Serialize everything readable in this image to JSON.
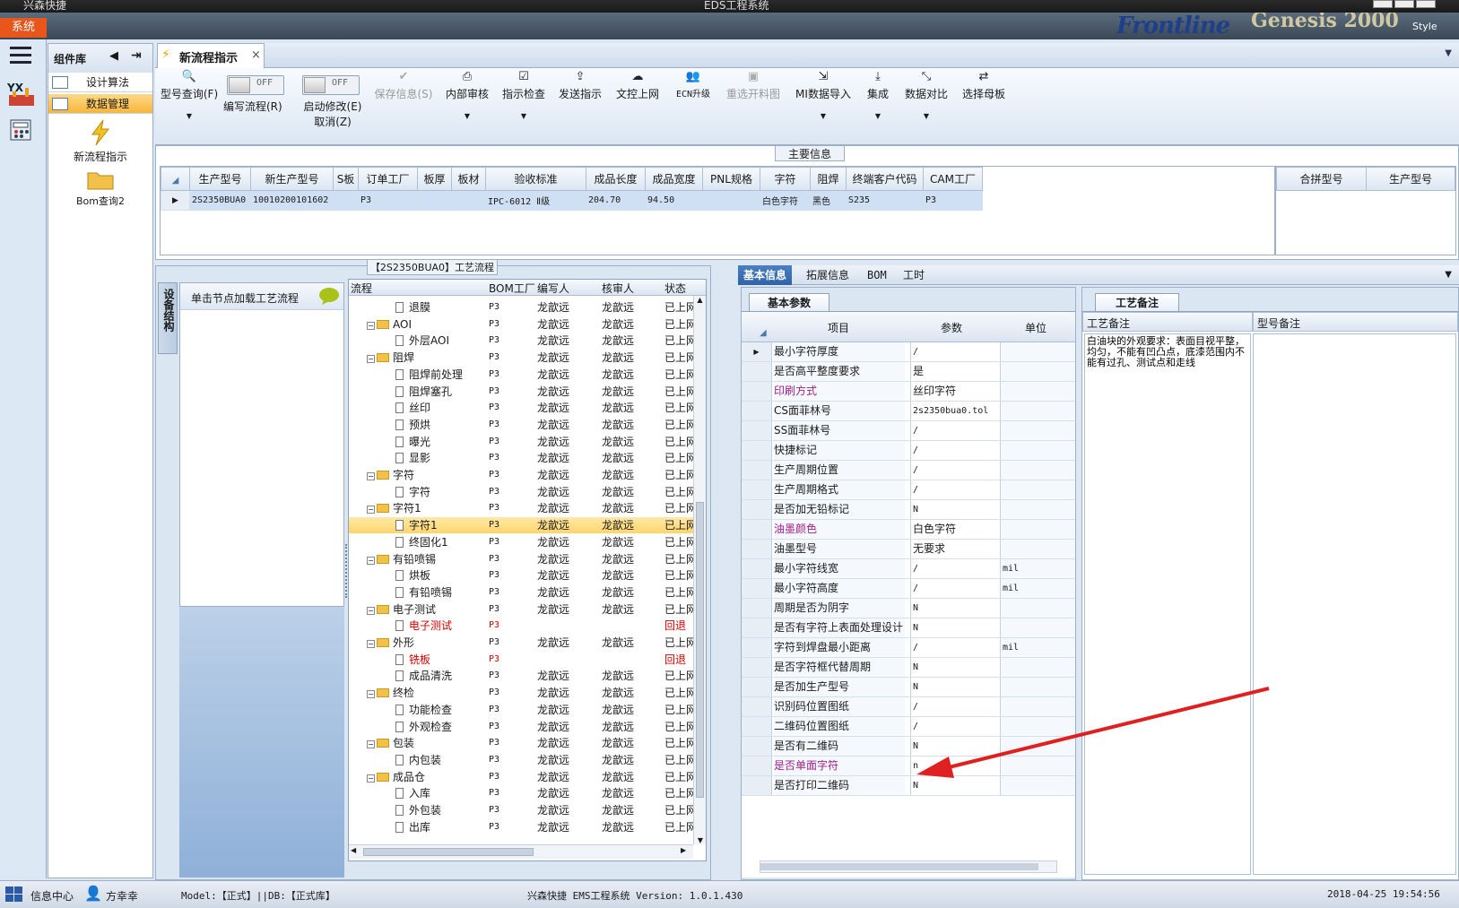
{
  "titlebar": {
    "app": "兴森快捷",
    "center": "EDS工程系统"
  },
  "appbar": {
    "system_btn": "系统",
    "brand1": "Frontline",
    "brand2": "Genesis 2000",
    "style_btn": "Style"
  },
  "component_panel": {
    "title": "组件库",
    "items": [
      {
        "label": "设计算法"
      },
      {
        "label": "数据管理"
      }
    ],
    "big_items": [
      {
        "label": "新流程指示"
      },
      {
        "label": "Bom查询2"
      }
    ]
  },
  "main_tab": {
    "label": "新流程指示"
  },
  "toolbar": {
    "buttons": [
      {
        "label": "型号查询(F)",
        "icon": "search-icon"
      },
      {
        "label": "编写流程(R)",
        "toggle": "OFF"
      },
      {
        "label": "启动修改(E)",
        "label2": "取消(Z)",
        "toggle": "OFF"
      },
      {
        "label": "保存信息(S)",
        "icon": "check-icon"
      },
      {
        "label": "内部审核",
        "icon": "print-icon"
      },
      {
        "label": "指示检查",
        "icon": "checkbox-icon"
      },
      {
        "label": "发送指示",
        "icon": "upload-icon"
      },
      {
        "label": "文控上网",
        "icon": "cloud-upload-icon"
      },
      {
        "label": "ECN升级",
        "icon": "users-icon"
      },
      {
        "label": "重选开料图",
        "icon": "image-icon"
      },
      {
        "label": "MI数据导入",
        "icon": "import-icon"
      },
      {
        "label": "集成",
        "icon": "download-icon"
      },
      {
        "label": "数据对比",
        "icon": "compare-icon"
      },
      {
        "label": "选择母板",
        "icon": "shuffle-icon"
      }
    ]
  },
  "main_info": {
    "title": "主要信息",
    "columns": [
      "生产型号",
      "新生产型号",
      "S板",
      "订单工厂",
      "板厚",
      "板材",
      "验收标准",
      "成品长度",
      "成品宽度",
      "PNL规格",
      "字符",
      "阻焊",
      "终端客户代码",
      "CAM工厂"
    ],
    "row": [
      "2S2350BUA0",
      "10010200101602",
      "",
      "P3",
      "",
      "",
      "IPC-6012 Ⅱ级",
      "204.70",
      "94.50",
      "",
      "白色字符",
      "黑色",
      "S235",
      "P3"
    ],
    "side_columns": [
      "合拼型号",
      "生产型号"
    ]
  },
  "process": {
    "equip_tab": "设备结构",
    "equip_hint": "单击节点加载工艺流程",
    "title": "【2S2350BUA0】工艺流程",
    "columns": [
      "流程",
      "BOM工厂",
      "编写人",
      "核审人",
      "状态"
    ],
    "rows": [
      {
        "name": "退膜",
        "lvl": 2,
        "bom": "P3",
        "w": "龙歆远",
        "r": "龙歆远",
        "s": "已上网"
      },
      {
        "name": "AOI",
        "lvl": 1,
        "bom": "P3",
        "w": "龙歆远",
        "r": "龙歆远",
        "s": "已上网"
      },
      {
        "name": "外层AOI",
        "lvl": 2,
        "bom": "P3",
        "w": "龙歆远",
        "r": "龙歆远",
        "s": "已上网"
      },
      {
        "name": "阻焊",
        "lvl": 1,
        "bom": "P3",
        "w": "龙歆远",
        "r": "龙歆远",
        "s": "已上网"
      },
      {
        "name": "阻焊前处理",
        "lvl": 2,
        "bom": "P3",
        "w": "龙歆远",
        "r": "龙歆远",
        "s": "已上网"
      },
      {
        "name": "阻焊塞孔",
        "lvl": 2,
        "bom": "P3",
        "w": "龙歆远",
        "r": "龙歆远",
        "s": "已上网"
      },
      {
        "name": "丝印",
        "lvl": 2,
        "bom": "P3",
        "w": "龙歆远",
        "r": "龙歆远",
        "s": "已上网"
      },
      {
        "name": "预烘",
        "lvl": 2,
        "bom": "P3",
        "w": "龙歆远",
        "r": "龙歆远",
        "s": "已上网"
      },
      {
        "name": "曝光",
        "lvl": 2,
        "bom": "P3",
        "w": "龙歆远",
        "r": "龙歆远",
        "s": "已上网"
      },
      {
        "name": "显影",
        "lvl": 2,
        "bom": "P3",
        "w": "龙歆远",
        "r": "龙歆远",
        "s": "已上网"
      },
      {
        "name": "字符",
        "lvl": 1,
        "bom": "P3",
        "w": "龙歆远",
        "r": "龙歆远",
        "s": "已上网"
      },
      {
        "name": "字符",
        "lvl": 2,
        "bom": "P3",
        "w": "龙歆远",
        "r": "龙歆远",
        "s": "已上网"
      },
      {
        "name": "字符1",
        "lvl": 1,
        "bom": "P3",
        "w": "龙歆远",
        "r": "龙歆远",
        "s": "已上网"
      },
      {
        "name": "字符1",
        "lvl": 2,
        "bom": "P3",
        "w": "龙歆远",
        "r": "龙歆远",
        "s": "已上网",
        "sel": true
      },
      {
        "name": "终固化1",
        "lvl": 2,
        "bom": "P3",
        "w": "龙歆远",
        "r": "龙歆远",
        "s": "已上网"
      },
      {
        "name": "有铅喷锡",
        "lvl": 1,
        "bom": "P3",
        "w": "龙歆远",
        "r": "龙歆远",
        "s": "已上网"
      },
      {
        "name": "烘板",
        "lvl": 2,
        "bom": "P3",
        "w": "龙歆远",
        "r": "龙歆远",
        "s": "已上网"
      },
      {
        "name": "有铅喷锡",
        "lvl": 2,
        "bom": "P3",
        "w": "龙歆远",
        "r": "龙歆远",
        "s": "已上网"
      },
      {
        "name": "电子测试",
        "lvl": 1,
        "bom": "P3",
        "w": "龙歆远",
        "r": "龙歆远",
        "s": "已上网"
      },
      {
        "name": "电子测试",
        "lvl": 2,
        "bom": "P3",
        "w": "",
        "r": "",
        "s": "回退",
        "red": true
      },
      {
        "name": "外形",
        "lvl": 1,
        "bom": "P3",
        "w": "龙歆远",
        "r": "龙歆远",
        "s": "已上网"
      },
      {
        "name": "铣板",
        "lvl": 2,
        "bom": "P3",
        "w": "",
        "r": "",
        "s": "回退",
        "red": true
      },
      {
        "name": "成品清洗",
        "lvl": 2,
        "bom": "P3",
        "w": "龙歆远",
        "r": "龙歆远",
        "s": "已上网"
      },
      {
        "name": "终检",
        "lvl": 1,
        "bom": "P3",
        "w": "龙歆远",
        "r": "龙歆远",
        "s": "已上网"
      },
      {
        "name": "功能检查",
        "lvl": 2,
        "bom": "P3",
        "w": "龙歆远",
        "r": "龙歆远",
        "s": "已上网"
      },
      {
        "name": "外观检查",
        "lvl": 2,
        "bom": "P3",
        "w": "龙歆远",
        "r": "龙歆远",
        "s": "已上网"
      },
      {
        "name": "包装",
        "lvl": 1,
        "bom": "P3",
        "w": "龙歆远",
        "r": "龙歆远",
        "s": "已上网"
      },
      {
        "name": "内包装",
        "lvl": 2,
        "bom": "P3",
        "w": "龙歆远",
        "r": "龙歆远",
        "s": "已上网"
      },
      {
        "name": "成品仓",
        "lvl": 1,
        "bom": "P3",
        "w": "龙歆远",
        "r": "龙歆远",
        "s": "已上网"
      },
      {
        "name": "入库",
        "lvl": 2,
        "bom": "P3",
        "w": "龙歆远",
        "r": "龙歆远",
        "s": "已上网"
      },
      {
        "name": "外包装",
        "lvl": 2,
        "bom": "P3",
        "w": "龙歆远",
        "r": "龙歆远",
        "s": "已上网"
      },
      {
        "name": "出库",
        "lvl": 2,
        "bom": "P3",
        "w": "龙歆远",
        "r": "龙歆远",
        "s": "已上网"
      }
    ]
  },
  "right_tabs": [
    "基本信息",
    "拓展信息",
    "BOM",
    "工时"
  ],
  "basic": {
    "subtab": "基本参数",
    "columns": [
      "项目",
      "参数",
      "单位"
    ],
    "rows": [
      {
        "k": "最小字符厚度",
        "v": "/",
        "u": ""
      },
      {
        "k": "是否高平整度要求",
        "v": "是",
        "u": ""
      },
      {
        "k": "印刷方式",
        "v": "丝印字符",
        "u": "",
        "p": true
      },
      {
        "k": "CS面菲林号",
        "v": "2s2350bua0.tol",
        "u": ""
      },
      {
        "k": "SS面菲林号",
        "v": "/",
        "u": ""
      },
      {
        "k": "快捷标记",
        "v": "/",
        "u": ""
      },
      {
        "k": "生产周期位置",
        "v": "/",
        "u": ""
      },
      {
        "k": "生产周期格式",
        "v": "/",
        "u": ""
      },
      {
        "k": "是否加无铅标记",
        "v": "N",
        "u": ""
      },
      {
        "k": "油墨颜色",
        "v": "白色字符",
        "u": "",
        "p": true
      },
      {
        "k": "油墨型号",
        "v": "无要求",
        "u": ""
      },
      {
        "k": "最小字符线宽",
        "v": "/",
        "u": "mil"
      },
      {
        "k": "最小字符高度",
        "v": "/",
        "u": "mil"
      },
      {
        "k": "周期是否为阴字",
        "v": "N",
        "u": ""
      },
      {
        "k": "是否有字符上表面处理设计",
        "v": "N",
        "u": ""
      },
      {
        "k": "字符到焊盘最小距离",
        "v": "/",
        "u": "mil"
      },
      {
        "k": "是否字符框代替周期",
        "v": "N",
        "u": ""
      },
      {
        "k": "是否加生产型号",
        "v": "N",
        "u": ""
      },
      {
        "k": "识别码位置图纸",
        "v": "/",
        "u": ""
      },
      {
        "k": "二维码位置图纸",
        "v": "/",
        "u": ""
      },
      {
        "k": "是否有二维码",
        "v": "N",
        "u": ""
      },
      {
        "k": "是否单面字符",
        "v": "n",
        "u": "",
        "p": true
      },
      {
        "k": "是否打印二维码",
        "v": "N",
        "u": ""
      }
    ]
  },
  "remarks": {
    "tab": "工艺备注",
    "col1": "工艺备注",
    "col2": "型号备注",
    "text": "白油块的外观要求：表面目视平整，均匀，不能有凹凸点，底漆范围内不能有过孔、测试点和走线"
  },
  "status": {
    "info_center": "信息中心",
    "user": "方幸幸",
    "model_db": "Model:【正式】||DB:【正式库】",
    "version": "兴森快捷 EMS工程系统 Version: 1.0.1.430",
    "datetime": "2018-04-25 19:54:56"
  },
  "colors": {
    "accent": "#2f63a8",
    "selected": "#ffd56b",
    "red": "#dd0000",
    "purple": "#a0208a"
  }
}
